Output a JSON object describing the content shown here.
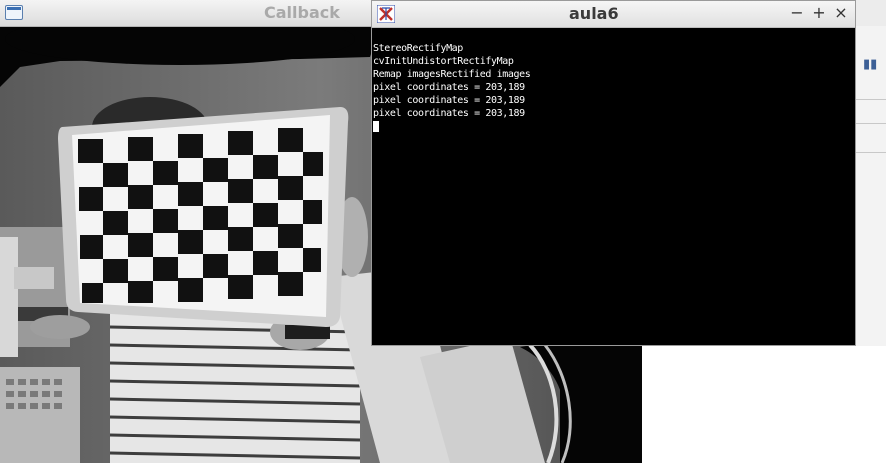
{
  "callback_window": {
    "title": "Callback"
  },
  "terminal_window": {
    "title": "aula6",
    "buttons": {
      "minimize": "−",
      "maximize": "+",
      "close": "×"
    },
    "lines": [
      "StereoRectifyMap",
      "cvInitUndistortRectifyMap",
      "Remap imagesRectified images",
      "pixel coordinates = 203,189",
      "pixel coordinates = 203,189",
      "pixel coordinates = 203,189"
    ]
  },
  "side_app": {
    "icon": "columns-icon"
  },
  "colors": {
    "terminal_bg": "#000000",
    "terminal_fg": "#ffffff",
    "app_icon_red": "#c0302b",
    "app_icon_blue": "#2c4aa8"
  }
}
